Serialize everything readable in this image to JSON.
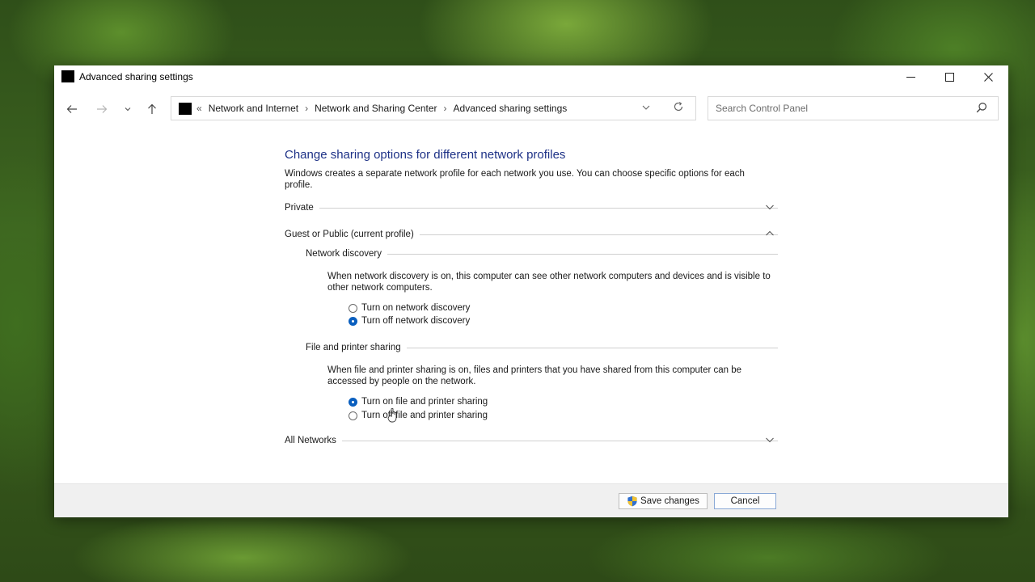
{
  "window": {
    "title": "Advanced sharing settings"
  },
  "address_bar": {
    "lead": "«",
    "crumbs": [
      "Network and Internet",
      "Network and Sharing Center",
      "Advanced sharing settings"
    ],
    "separator": "›"
  },
  "search": {
    "placeholder": "Search Control Panel"
  },
  "main": {
    "title": "Change sharing options for different network profiles",
    "intro": "Windows creates a separate network profile for each network you use. You can choose specific options for each profile.",
    "profiles": {
      "private": {
        "label": "Private",
        "expanded": false
      },
      "guest_public": {
        "label": "Guest or Public (current profile)",
        "expanded": true,
        "network_discovery": {
          "heading": "Network discovery",
          "description": "When network discovery is on, this computer can see other network computers and devices and is visible to other network computers.",
          "options": [
            {
              "label": "Turn on network discovery",
              "checked": false
            },
            {
              "label": "Turn off network discovery",
              "checked": true
            }
          ]
        },
        "file_printer_sharing": {
          "heading": "File and printer sharing",
          "description": "When file and printer sharing is on, files and printers that you have shared from this computer can be accessed by people on the network.",
          "options": [
            {
              "label": "Turn on file and printer sharing",
              "checked": true
            },
            {
              "label": "Turn off file and printer sharing",
              "checked": false
            }
          ]
        }
      },
      "all_networks": {
        "label": "All Networks",
        "expanded": false
      }
    }
  },
  "footer": {
    "save_label": "Save changes",
    "cancel_label": "Cancel"
  },
  "colors": {
    "title_blue": "#1e3287",
    "radio_blue": "#0a5fbf"
  }
}
